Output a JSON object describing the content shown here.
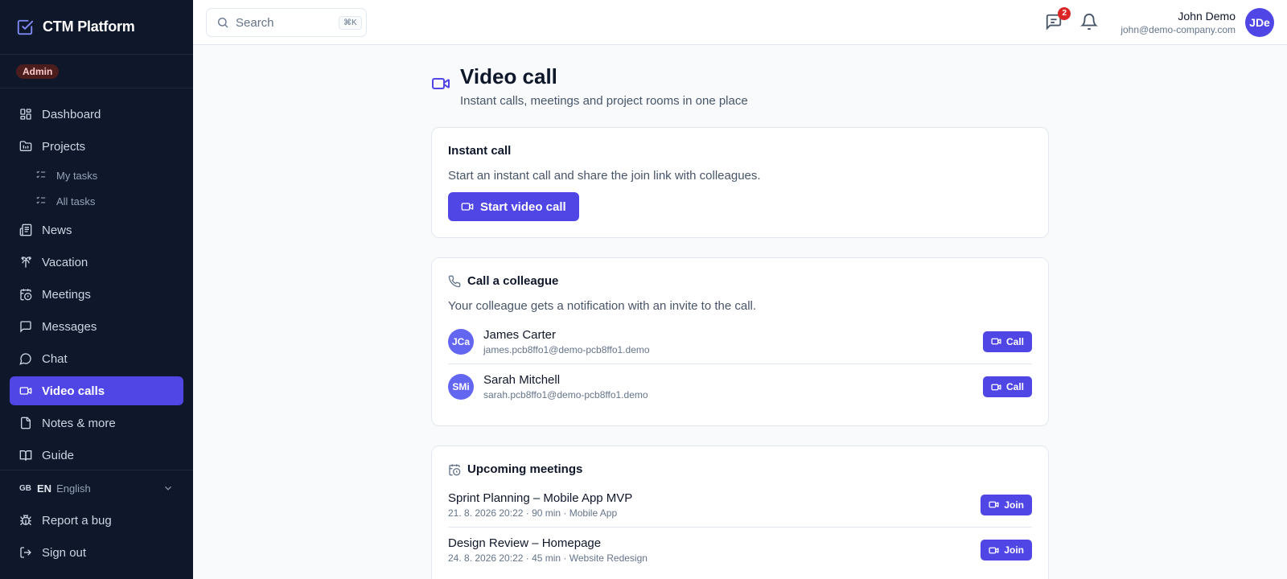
{
  "app": {
    "name": "CTM Platform",
    "role_badge": "Admin"
  },
  "sidebar": {
    "items": [
      {
        "label": "Dashboard",
        "icon": "dashboard-icon"
      },
      {
        "label": "Projects",
        "icon": "folder-icon"
      },
      {
        "label": "My tasks",
        "icon": "list-check-icon",
        "sub": true
      },
      {
        "label": "All tasks",
        "icon": "list-check-icon",
        "sub": true
      },
      {
        "label": "News",
        "icon": "newspaper-icon"
      },
      {
        "label": "Vacation",
        "icon": "palm-tree-icon"
      },
      {
        "label": "Meetings",
        "icon": "calendar-clock-icon"
      },
      {
        "label": "Messages",
        "icon": "message-square-icon"
      },
      {
        "label": "Chat",
        "icon": "chat-bubble-icon"
      },
      {
        "label": "Video calls",
        "icon": "video-icon",
        "active": true
      },
      {
        "label": "Notes & more",
        "icon": "file-icon"
      },
      {
        "label": "Guide",
        "icon": "book-icon"
      }
    ],
    "language": {
      "flag": "GB",
      "code": "EN",
      "name": "English"
    },
    "report_bug": "Report a bug",
    "sign_out": "Sign out"
  },
  "topbar": {
    "search_placeholder": "Search",
    "search_shortcut": "⌘K",
    "messages_badge": "2",
    "user": {
      "name": "John Demo",
      "email": "john@demo-company.com",
      "initials": "JDe"
    }
  },
  "page": {
    "title": "Video call",
    "subtitle": "Instant calls, meetings and project rooms in one place"
  },
  "instant_call": {
    "title": "Instant call",
    "description": "Start an instant call and share the join link with colleagues.",
    "button": "Start video call"
  },
  "call_colleague": {
    "title": "Call a colleague",
    "description": "Your colleague gets a notification with an invite to the call.",
    "call_label": "Call",
    "people": [
      {
        "initials": "JCa",
        "name": "James Carter",
        "email": "james.pcb8ffo1@demo-pcb8ffo1.demo"
      },
      {
        "initials": "SMi",
        "name": "Sarah Mitchell",
        "email": "sarah.pcb8ffo1@demo-pcb8ffo1.demo"
      }
    ]
  },
  "upcoming": {
    "title": "Upcoming meetings",
    "join_label": "Join",
    "meetings": [
      {
        "name": "Sprint Planning – Mobile App MVP",
        "meta": "21. 8. 2026 20:22 · 90 min · Mobile App"
      },
      {
        "name": "Design Review – Homepage",
        "meta": "24. 8. 2026 20:22 · 45 min · Website Redesign"
      }
    ]
  },
  "colors": {
    "accent": "#4f46e5",
    "sidebar_bg": "#0f172a",
    "badge_red": "#dc2626"
  }
}
